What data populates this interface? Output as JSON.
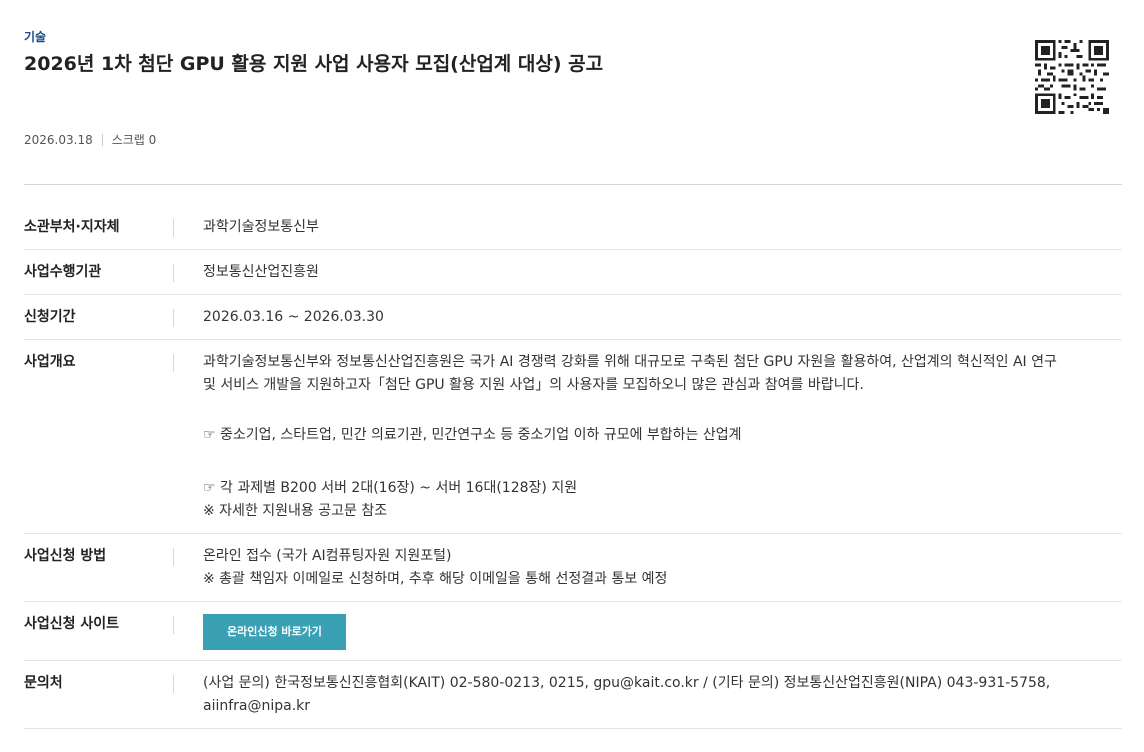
{
  "category": "기술",
  "title": "2026년 1차 첨단 GPU 활용 지원 사업 사용자 모집(산업계 대상) 공고",
  "meta": {
    "date": "2026.03.18",
    "scrap_label": "스크랩 0"
  },
  "info": {
    "dept": {
      "label": "소관부처·지자체",
      "value": "과학기술정보통신부"
    },
    "agency": {
      "label": "사업수행기관",
      "value": "정보통신산업진흥원"
    },
    "period": {
      "label": "신청기간",
      "value": "2026.03.16 ~ 2026.03.30"
    },
    "summary": {
      "label": "사업개요",
      "line1": "과학기술정보통신부와 정보통신산업진흥원은 국가 AI 경쟁력 강화를 위해 대규모로 구축된 첨단 GPU 자원을 활용하여, 산업계의 혁신적인 AI 연구",
      "line2": "및 서비스 개발을 지원하고자「첨단 GPU 활용 지원 사업」의 사용자를 모집하오니 많은 관심과 참여를 바랍니다.",
      "line3": "☞ 중소기업, 스타트업, 민간 의료기관, 민간연구소 등 중소기업 이하 규모에 부합하는 산업계",
      "line4": "☞ 각 과제별 B200 서버 2대(16장) ~ 서버 16대(128장) 지원",
      "line5": "※ 자세한 지원내용 공고문 참조"
    },
    "method": {
      "label": "사업신청 방법",
      "line1": "온라인 접수 (국가 AI컴퓨팅자원 지원포털)",
      "line2": "※ 총괄 책임자 이메일로 신청하며, 추후 해당 이메일을 통해 선정결과 통보 예정"
    },
    "site": {
      "label": "사업신청 사이트",
      "button": "온라인신청 바로가기"
    },
    "contact": {
      "label": "문의처",
      "line1": "(사업 문의) 한국정보통신진흥협회(KAIT) 02-580-0213, 0215, gpu@kait.co.kr / (기타 문의) 정보통신산업진흥원(NIPA) 043-931-5758,",
      "line2": "aiinfra@nipa.kr"
    }
  },
  "colors": {
    "category": "#1a4a8a",
    "button_bg": "#3aa0b4"
  },
  "icons": {
    "qr": "qr-code-icon"
  }
}
